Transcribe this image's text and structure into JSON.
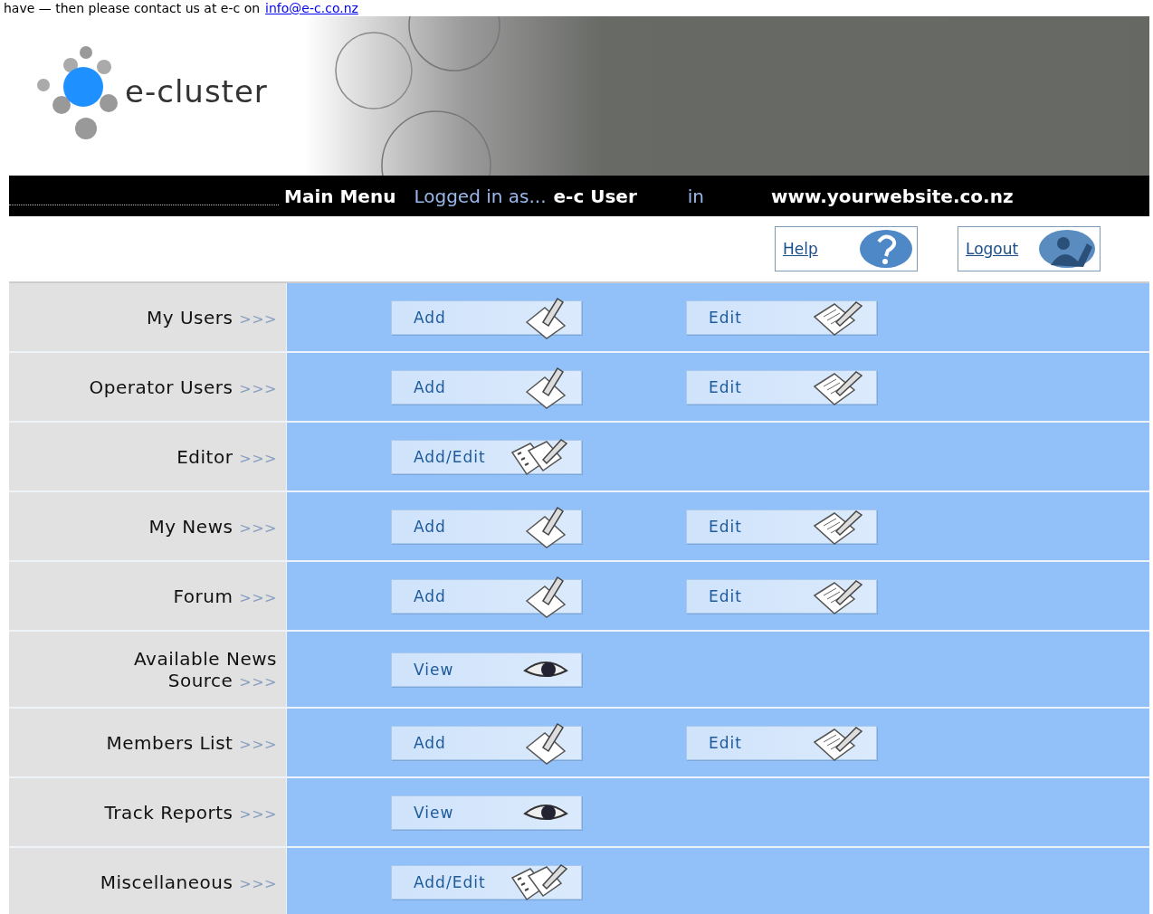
{
  "notice": {
    "text": "have — then please contact us at e-c on",
    "link": "info@e-c.co.nz"
  },
  "logo": {
    "text": "e-cluster"
  },
  "nav_bar": {
    "menu": "Main Menu",
    "logged_in_label": "Logged in as...",
    "user": "e-c User",
    "in_label": "in",
    "site": "www.yourwebsite.co.nz"
  },
  "top_buttons": [
    {
      "label": "Help",
      "kind": "help"
    },
    {
      "label": "Logout",
      "kind": "logout"
    }
  ],
  "rows": [
    {
      "label": "My Users",
      "arrows": ">>>",
      "actions": [
        {
          "label": "Add",
          "kind": "add"
        },
        {
          "label": "Edit",
          "kind": "edit"
        }
      ]
    },
    {
      "label": "Operator Users",
      "arrows": ">>>",
      "actions": [
        {
          "label": "Add",
          "kind": "add"
        },
        {
          "label": "Edit",
          "kind": "edit"
        }
      ]
    },
    {
      "label": "Editor",
      "arrows": ">>>",
      "actions": [
        {
          "label": "Add/Edit",
          "kind": "addedit"
        }
      ]
    },
    {
      "label": "My News",
      "arrows": ">>>",
      "actions": [
        {
          "label": "Add",
          "kind": "add"
        },
        {
          "label": "Edit",
          "kind": "edit"
        }
      ]
    },
    {
      "label": "Forum",
      "arrows": ">>>",
      "actions": [
        {
          "label": "Add",
          "kind": "add"
        },
        {
          "label": "Edit",
          "kind": "edit"
        }
      ]
    },
    {
      "label": "Available News Source",
      "arrows": ">>>",
      "actions": [
        {
          "label": "View",
          "kind": "view"
        }
      ]
    },
    {
      "label": "Members List",
      "arrows": ">>>",
      "actions": [
        {
          "label": "Add",
          "kind": "add"
        },
        {
          "label": "Edit",
          "kind": "edit"
        }
      ]
    },
    {
      "label": "Track Reports",
      "arrows": ">>>",
      "actions": [
        {
          "label": "View",
          "kind": "view"
        }
      ]
    },
    {
      "label": "Miscellaneous",
      "arrows": ">>>",
      "actions": [
        {
          "label": "Add/Edit",
          "kind": "addedit"
        }
      ]
    }
  ]
}
